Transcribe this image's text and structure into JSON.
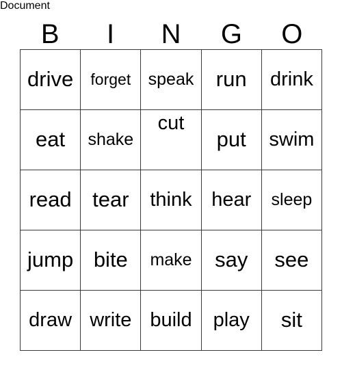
{
  "card": {
    "header": {
      "letters": [
        "B",
        "I",
        "N",
        "G",
        "O"
      ]
    },
    "rows": [
      {
        "cells": [
          {
            "word": "drive",
            "size": "lg",
            "align": "center"
          },
          {
            "word": "forget",
            "size": "xs",
            "align": "center"
          },
          {
            "word": "speak",
            "size": "sm",
            "align": "center"
          },
          {
            "word": "run",
            "size": "lg",
            "align": "center"
          },
          {
            "word": "drink",
            "size": "md",
            "align": "center"
          }
        ]
      },
      {
        "cells": [
          {
            "word": "eat",
            "size": "lg",
            "align": "center"
          },
          {
            "word": "shake",
            "size": "sm",
            "align": "center"
          },
          {
            "word": "cut",
            "size": "md",
            "align": "top"
          },
          {
            "word": "put",
            "size": "lg",
            "align": "center"
          },
          {
            "word": "swim",
            "size": "md",
            "align": "center"
          }
        ]
      },
      {
        "cells": [
          {
            "word": "read",
            "size": "lg",
            "align": "center"
          },
          {
            "word": "tear",
            "size": "lg",
            "align": "center"
          },
          {
            "word": "think",
            "size": "md",
            "align": "center"
          },
          {
            "word": "hear",
            "size": "md",
            "align": "center"
          },
          {
            "word": "sleep",
            "size": "sm",
            "align": "center"
          }
        ]
      },
      {
        "cells": [
          {
            "word": "jump",
            "size": "lg",
            "align": "center"
          },
          {
            "word": "bite",
            "size": "lg",
            "align": "center"
          },
          {
            "word": "make",
            "size": "sm",
            "align": "center"
          },
          {
            "word": "say",
            "size": "lg",
            "align": "center"
          },
          {
            "word": "see",
            "size": "lg",
            "align": "center"
          }
        ]
      },
      {
        "cells": [
          {
            "word": "draw",
            "size": "md",
            "align": "center"
          },
          {
            "word": "write",
            "size": "md",
            "align": "center"
          },
          {
            "word": "build",
            "size": "md",
            "align": "center"
          },
          {
            "word": "play",
            "size": "md",
            "align": "center"
          },
          {
            "word": "sit",
            "size": "lg",
            "align": "center"
          }
        ]
      }
    ]
  },
  "colors": {
    "background": "#ffffff",
    "text": "#000000",
    "border": "#3a3a3a"
  }
}
